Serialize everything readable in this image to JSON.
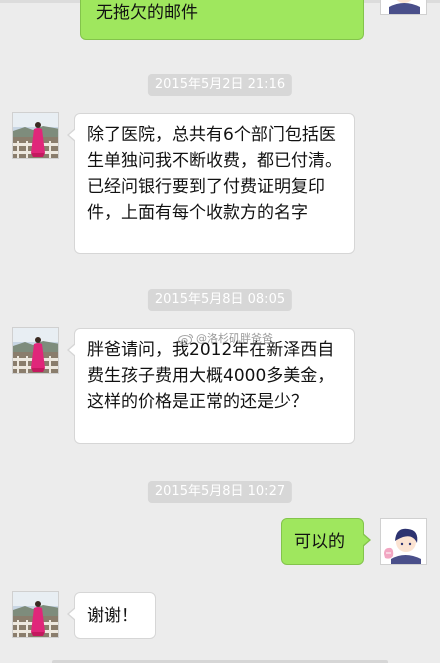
{
  "chat": {
    "messages": [
      {
        "id": "m0",
        "side": "out",
        "text": "无拖欠的邮件"
      },
      {
        "id": "m1",
        "side": "in",
        "timestamp": "2015年5月2日 21:16",
        "text": "除了医院，总共有6个部门包括医生单独问我不断收费，都已付清。已经问银行要到了付费证明复印件，上面有每个收款方的名字"
      },
      {
        "id": "m2",
        "side": "in",
        "timestamp": "2015年5月8日 08:05",
        "text": "胖爸请问，我2012年在新泽西自费生孩子费用大概4000多美金，这样的价格是正常的还是少？"
      },
      {
        "id": "m3",
        "side": "out",
        "timestamp": "2015年5月8日 10:27",
        "text": "可以的"
      },
      {
        "id": "m4",
        "side": "in",
        "text": "谢谢！"
      }
    ],
    "watermark": "@洛杉矶胖爸爸"
  },
  "icons": {
    "contact_avatar": "contact-avatar-icon",
    "self_avatar": "self-avatar-icon",
    "weibo": "weibo-logo-icon"
  },
  "colors": {
    "background": "#ececec",
    "incoming_bubble": "#ffffff",
    "outgoing_bubble": "#9fe75e",
    "timestamp_pill": "#d7d7d7"
  }
}
